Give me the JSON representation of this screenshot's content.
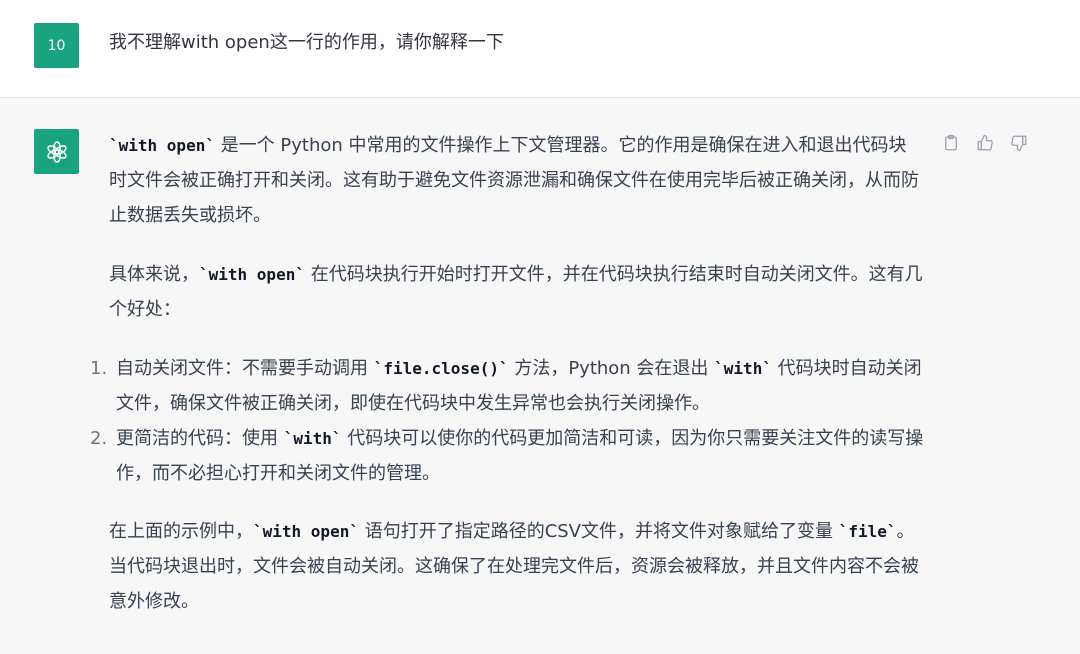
{
  "user_message": {
    "avatar_label": "10",
    "text": "我不理解with open这一行的作用，请你解释一下"
  },
  "assistant_message": {
    "avatar_icon": "openai-logo-icon",
    "paragraph1": {
      "code1": "`with open`",
      "text1": " 是一个 Python 中常用的文件操作上下文管理器。它的作用是确保在进入和退出代码块时文件会被正确打开和关闭。这有助于避免文件资源泄漏和确保文件在使用完毕后被正确关闭，从而防止数据丢失或损坏。"
    },
    "paragraph2": {
      "text1": "具体来说，",
      "code1": "`with open`",
      "text2": " 在代码块执行开始时打开文件，并在代码块执行结束时自动关闭文件。这有几个好处："
    },
    "list": [
      {
        "number": "1.",
        "text1": "自动关闭文件：不需要手动调用 ",
        "code1": "`file.close()`",
        "text2": " 方法，Python 会在退出 ",
        "code2": "`with`",
        "text3": " 代码块时自动关闭文件，确保文件被正确关闭，即使在代码块中发生异常也会执行关闭操作。"
      },
      {
        "number": "2.",
        "text1": "更简洁的代码：使用 ",
        "code1": "`with`",
        "text2": " 代码块可以使你的代码更加简洁和可读，因为你只需要关注文件的读写操作，而不必担心打开和关闭文件的管理。"
      }
    ],
    "paragraph3": {
      "text1": "在上面的示例中，",
      "code1": "`with open`",
      "text2": " 语句打开了指定路径的CSV文件，并将文件对象赋给了变量 ",
      "code2": "`file`",
      "text3": "。当代码块退出时，文件会被自动关闭。这确保了在处理完文件后，资源会被释放，并且文件内容不会被意外修改。"
    }
  },
  "actions": {
    "copy_icon": "clipboard-icon",
    "like_icon": "thumbs-up-icon",
    "dislike_icon": "thumbs-down-icon"
  },
  "colors": {
    "avatar_bg": "#19a37f",
    "assistant_bg": "#f7f7f8",
    "text": "#374151"
  }
}
